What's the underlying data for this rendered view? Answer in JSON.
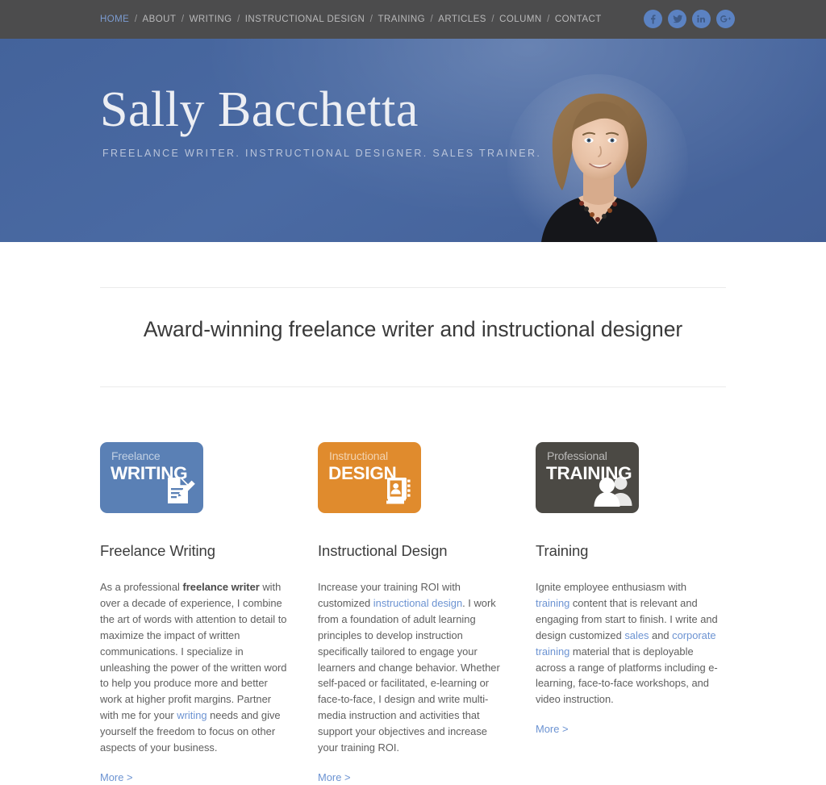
{
  "topbar": {
    "nav_items": [
      {
        "label": "HOME",
        "active": true
      },
      {
        "label": "ABOUT",
        "active": false
      },
      {
        "label": "WRITING",
        "active": false
      },
      {
        "label": "INSTRUCTIONAL DESIGN",
        "active": false
      },
      {
        "label": "TRAINING",
        "active": false
      },
      {
        "label": "ARTICLES",
        "active": false
      },
      {
        "label": "COLUMN",
        "active": false
      },
      {
        "label": "CONTACT",
        "active": false
      }
    ],
    "separator": "/",
    "social": [
      {
        "name": "facebook-icon",
        "label": "f"
      },
      {
        "name": "twitter-icon",
        "label": "t"
      },
      {
        "name": "linkedin-icon",
        "label": "in"
      },
      {
        "name": "google-plus-icon",
        "label": "G+"
      }
    ],
    "colors": {
      "background": "#4c4c4d",
      "link": "#b9b9ba",
      "link_active": "#7b9bd1",
      "social_bg": "#5b82c2"
    }
  },
  "hero": {
    "title": "Sally Bacchetta",
    "tagline": "FREELANCE WRITER. INSTRUCTIONAL DESIGNER. SALES TRAINER.",
    "portrait_alt": "portrait-photo",
    "colors": {
      "background": "#47679e",
      "title": "#eceef3",
      "tagline": "#b9c4da"
    }
  },
  "main": {
    "headline": "Award-winning freelance writer and instructional designer",
    "columns": [
      {
        "tile": {
          "small_label": "Freelance",
          "large_label": "WRITING",
          "color": "#5a80b5",
          "glyph": "document-pencil-icon"
        },
        "title": "Freelance Writing",
        "body_parts": [
          {
            "type": "text",
            "text": "As a professional "
          },
          {
            "type": "bold",
            "text": "freelance writer"
          },
          {
            "type": "text",
            "text": " with over a decade of experience, I combine the art of words with attention to detail to maximize the impact of written communications. I specialize in unleashing the power of the written word to help you produce more and better work at higher profit margins. Partner with me for your "
          },
          {
            "type": "link",
            "text": "writing"
          },
          {
            "type": "text",
            "text": " needs and give yourself the freedom to focus on other aspects of your business."
          }
        ],
        "more_label": "More >"
      },
      {
        "tile": {
          "small_label": "Instructional",
          "large_label": "DESIGN",
          "color": "#e08b2d",
          "glyph": "contact-book-icon"
        },
        "title": "Instructional Design",
        "body_parts": [
          {
            "type": "text",
            "text": "Increase your training ROI with customized "
          },
          {
            "type": "link",
            "text": "instructional design"
          },
          {
            "type": "text",
            "text": ".  I work from a foundation of adult learning principles to develop instruction specifically tailored to engage your learners and change behavior. Whether self-paced or facilitated, e-learning or face-to-face, I design and write multi-media instruction and activities that support your objectives and increase your training ROI."
          }
        ],
        "more_label": "More >"
      },
      {
        "tile": {
          "small_label": "Professional",
          "large_label": "TRAINING",
          "color": "#4b4944",
          "glyph": "two-people-icon"
        },
        "title": "Training",
        "body_parts": [
          {
            "type": "text",
            "text": "Ignite employee enthusiasm with "
          },
          {
            "type": "link",
            "text": "training"
          },
          {
            "type": "text",
            "text": " content that is relevant and engaging from start to finish. I write and design customized "
          },
          {
            "type": "link",
            "text": "sales"
          },
          {
            "type": "text",
            "text": " and "
          },
          {
            "type": "link",
            "text": "corporate training"
          },
          {
            "type": "text",
            "text": " material that is deployable across a range of platforms including e-learning, face-to-face workshops, and video instruction."
          }
        ],
        "more_label": "More >"
      }
    ],
    "colors": {
      "headline": "#3a3a3a",
      "body": "#5e5e5e",
      "link": "#6c93d2",
      "divider": "#ebebeb"
    }
  }
}
